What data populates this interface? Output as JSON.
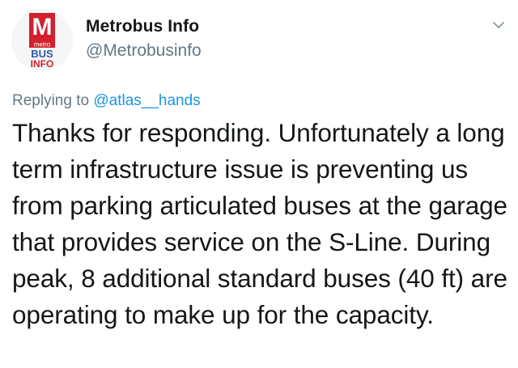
{
  "profile": {
    "avatar_label": "metro BUS INFO",
    "display_name": "Metrobus Info",
    "handle": "@Metrobusinfo"
  },
  "reply": {
    "prefix": "Replying to",
    "mention": "@atlas__hands"
  },
  "tweet": {
    "text": "Thanks for responding. Unfortunately a long term infrastructure issue is preventing us from parking articulated buses at the garage that provides service on the S-Line. During peak, 8 additional standard buses (40 ft) are operating to make up for the capacity."
  },
  "icons": {
    "menu": "chevron-down-icon"
  },
  "colors": {
    "brand_red": "#d3202d",
    "link_blue": "#1b95e0",
    "secondary_text": "#657786",
    "primary_text": "#14171a"
  }
}
